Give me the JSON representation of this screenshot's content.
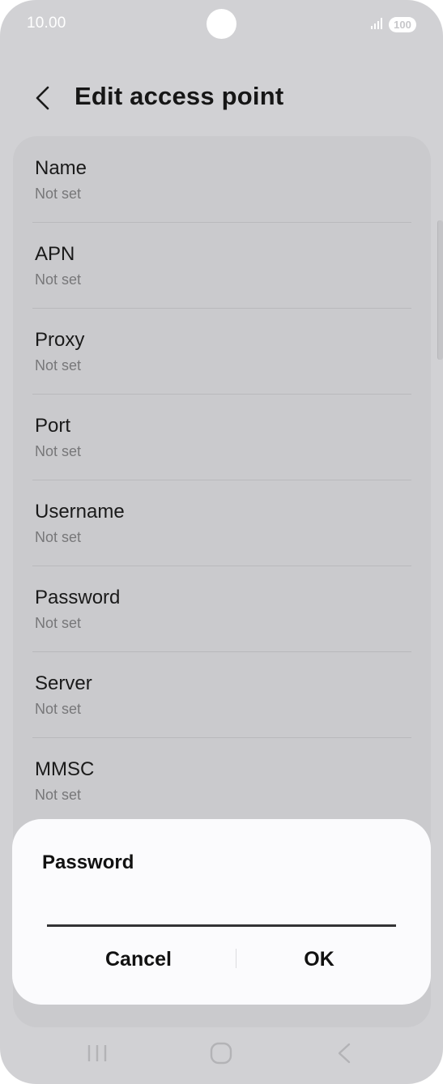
{
  "status_bar": {
    "time": "10.00",
    "battery_level": "100",
    "signal_icon": "signal-bars-icon"
  },
  "header": {
    "title": "Edit access point",
    "back_icon": "chevron-left-icon"
  },
  "settings": {
    "items": [
      {
        "label": "Name",
        "value": "Not set"
      },
      {
        "label": "APN",
        "value": "Not set"
      },
      {
        "label": "Proxy",
        "value": "Not set"
      },
      {
        "label": "Port",
        "value": "Not set"
      },
      {
        "label": "Username",
        "value": "Not set"
      },
      {
        "label": "Password",
        "value": "Not set"
      },
      {
        "label": "Server",
        "value": "Not set"
      },
      {
        "label": "MMSC",
        "value": "Not set"
      }
    ]
  },
  "dialog": {
    "title": "Password",
    "input_value": "",
    "cancel_label": "Cancel",
    "ok_label": "OK"
  },
  "nav_bar": {
    "recent_icon": "recent-apps-icon",
    "home_icon": "home-icon",
    "back_icon": "back-icon"
  },
  "colors": {
    "screen_dim": "#d1d1d4",
    "card": "#cacacd",
    "dialog_bg": "#fbfbfd",
    "text_primary": "#111111",
    "text_secondary": "#777779"
  }
}
